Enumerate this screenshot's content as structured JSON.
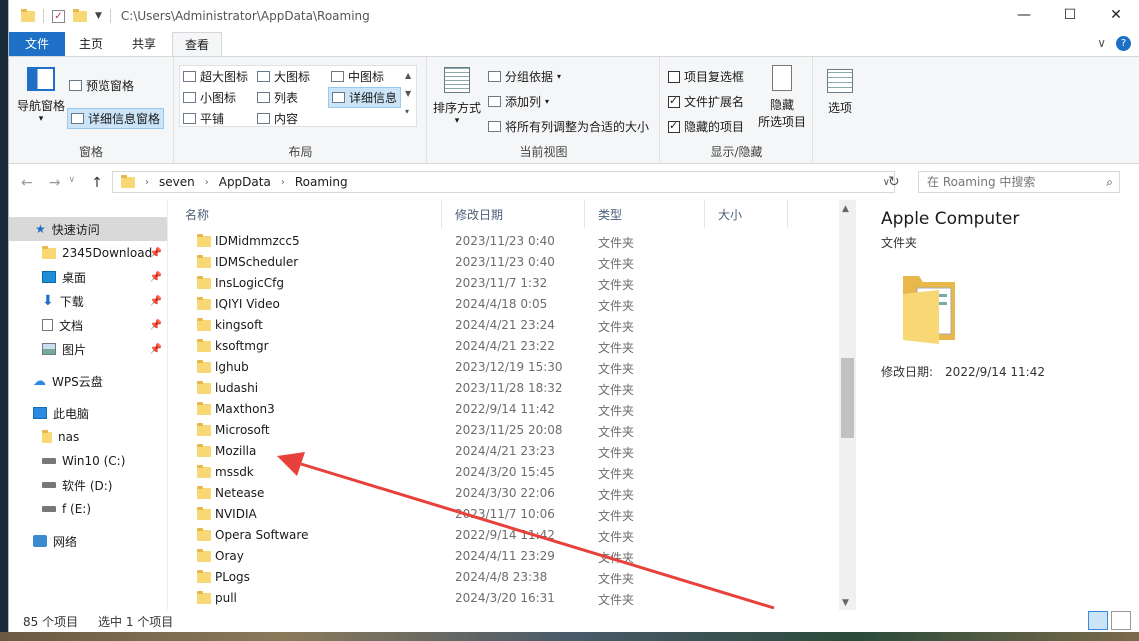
{
  "titlebar": {
    "path": "C:\\Users\\Administrator\\AppData\\Roaming"
  },
  "tabs": {
    "file": "文件",
    "home": "主页",
    "share": "共享",
    "view": "查看"
  },
  "ribbon": {
    "panes": {
      "nav_pane": "导航窗格",
      "preview_pane": "预览窗格",
      "details_pane": "详细信息窗格",
      "label": "窗格"
    },
    "layout": {
      "extra_large": "超大图标",
      "large": "大图标",
      "medium": "中图标",
      "small": "小图标",
      "list": "列表",
      "details": "详细信息",
      "tiles": "平铺",
      "content": "内容",
      "label": "布局"
    },
    "current_view": {
      "sort_by": "排序方式",
      "group_by": "分组依据",
      "add_columns": "添加列",
      "size_all": "将所有列调整为合适的大小",
      "label": "当前视图"
    },
    "show_hide": {
      "item_checkboxes": "项目复选框",
      "file_extensions": "文件扩展名",
      "hidden_items": "隐藏的项目",
      "hide_selected": "隐藏",
      "hide_selected2": "所选项目",
      "label": "显示/隐藏"
    },
    "options": "选项"
  },
  "address": {
    "segments": [
      "seven",
      "AppData",
      "Roaming"
    ],
    "search_placeholder": "在 Roaming 中搜索"
  },
  "navpane": {
    "quick_access": "快速访问",
    "items": [
      {
        "label": "2345Download"
      },
      {
        "label": "桌面"
      },
      {
        "label": "下载"
      },
      {
        "label": "文档"
      },
      {
        "label": "图片"
      }
    ],
    "wps": "WPS云盘",
    "this_pc": "此电脑",
    "drives": [
      {
        "label": "nas"
      },
      {
        "label": "Win10 (C:)"
      },
      {
        "label": "软件 (D:)"
      },
      {
        "label": "f (E:)"
      }
    ],
    "network": "网络"
  },
  "columns": {
    "name": "名称",
    "date": "修改日期",
    "type": "类型",
    "size": "大小"
  },
  "files": [
    {
      "name": "IDMidmmzcc5",
      "date": "2023/11/23 0:40",
      "type": "文件夹"
    },
    {
      "name": "IDMScheduler",
      "date": "2023/11/23 0:40",
      "type": "文件夹"
    },
    {
      "name": "InsLogicCfg",
      "date": "2023/11/7 1:32",
      "type": "文件夹"
    },
    {
      "name": "IQIYI Video",
      "date": "2024/4/18 0:05",
      "type": "文件夹"
    },
    {
      "name": "kingsoft",
      "date": "2024/4/21 23:24",
      "type": "文件夹"
    },
    {
      "name": "ksoftmgr",
      "date": "2024/4/21 23:22",
      "type": "文件夹"
    },
    {
      "name": "lghub",
      "date": "2023/12/19 15:30",
      "type": "文件夹"
    },
    {
      "name": "ludashi",
      "date": "2023/11/28 18:32",
      "type": "文件夹"
    },
    {
      "name": "Maxthon3",
      "date": "2022/9/14 11:42",
      "type": "文件夹"
    },
    {
      "name": "Microsoft",
      "date": "2023/11/25 20:08",
      "type": "文件夹"
    },
    {
      "name": "Mozilla",
      "date": "2024/4/21 23:23",
      "type": "文件夹"
    },
    {
      "name": "mssdk",
      "date": "2024/3/20 15:45",
      "type": "文件夹"
    },
    {
      "name": "Netease",
      "date": "2024/3/30 22:06",
      "type": "文件夹"
    },
    {
      "name": "NVIDIA",
      "date": "2023/11/7 10:06",
      "type": "文件夹"
    },
    {
      "name": "Opera Software",
      "date": "2022/9/14 11:42",
      "type": "文件夹"
    },
    {
      "name": "Oray",
      "date": "2024/4/11 23:29",
      "type": "文件夹"
    },
    {
      "name": "PLogs",
      "date": "2024/4/8 23:38",
      "type": "文件夹"
    },
    {
      "name": "pull",
      "date": "2024/3/20 16:31",
      "type": "文件夹"
    }
  ],
  "preview": {
    "title": "Apple Computer",
    "subtitle": "文件夹",
    "date_label": "修改日期:",
    "date_value": "2022/9/14 11:42"
  },
  "status": {
    "count": "85 个项目",
    "selected": "选中 1 个项目"
  },
  "colors": {
    "accent": "#1e6fc6",
    "folder": "#f8d775",
    "arrow": "#e8403a"
  }
}
